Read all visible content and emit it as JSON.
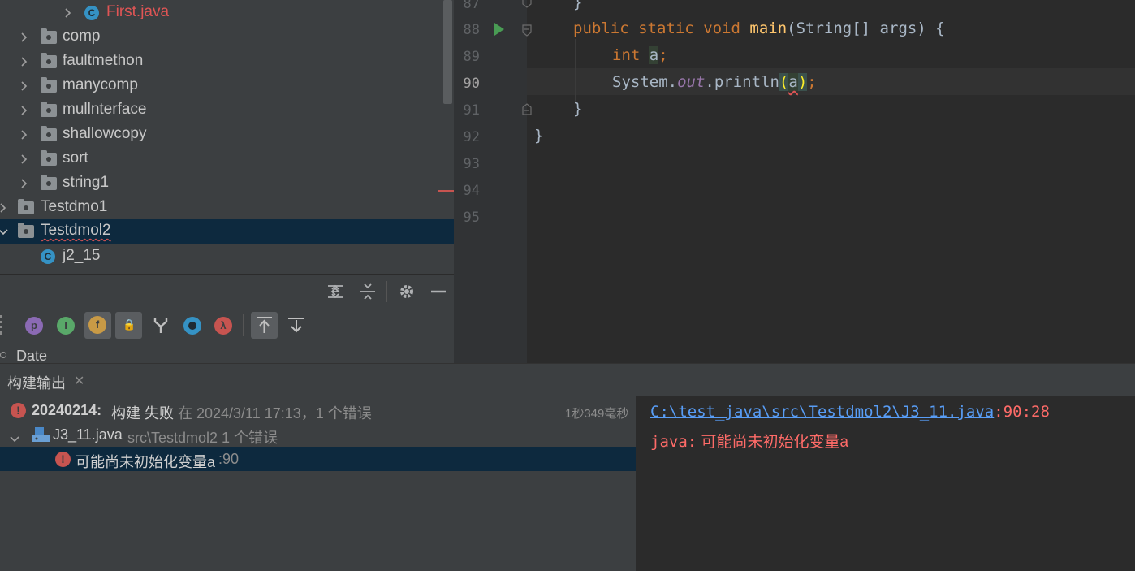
{
  "project_tree": {
    "items": [
      {
        "label": "First.java",
        "type": "class",
        "error": true
      },
      {
        "label": "comp",
        "type": "folder"
      },
      {
        "label": "faultmethon",
        "type": "folder"
      },
      {
        "label": "manycomp",
        "type": "folder"
      },
      {
        "label": "mullnterface",
        "type": "folder"
      },
      {
        "label": "shallowcopy",
        "type": "folder"
      },
      {
        "label": "sort",
        "type": "folder"
      },
      {
        "label": "string1",
        "type": "folder"
      },
      {
        "label": "Testdmo1",
        "type": "folder"
      },
      {
        "label": "Testdmol2",
        "type": "folder",
        "selected": true
      },
      {
        "label": "j2_15",
        "type": "class"
      }
    ],
    "class_icon_glyph": "C"
  },
  "structure": {
    "filter_icons": [
      "p",
      "I",
      "f",
      "🔒",
      "⑂",
      "●",
      "λ"
    ],
    "partial_label": "Date"
  },
  "editor": {
    "lines": [
      {
        "no": "87",
        "text": "}"
      },
      {
        "no": "88"
      },
      {
        "no": "89"
      },
      {
        "no": "90"
      },
      {
        "no": "91",
        "text": "}"
      },
      {
        "no": "92",
        "text": "}"
      },
      {
        "no": "93"
      },
      {
        "no": "94"
      },
      {
        "no": "95"
      }
    ],
    "tokens": {
      "public": "public",
      "static": "static",
      "void": "void",
      "main": "main",
      "sig": "(String[] args) {",
      "int": "int",
      "a": "a",
      "semi": ";",
      "system": "System.",
      "out": "out",
      "println": ".println",
      "lp": "(",
      "rp": ")"
    }
  },
  "build": {
    "tab_label": "构建输出",
    "summary": {
      "name": "20240214:",
      "status": "构建 失败",
      "detail": "在 2024/3/11 17:13，1 个错误",
      "duration": "1秒349毫秒"
    },
    "file": {
      "name": "J3_11.java",
      "path": "src\\Testdmol2 1 个错误"
    },
    "error": {
      "message": "可能尚未初始化变量a",
      "line": ":90"
    },
    "console": {
      "link": "C:\\test_java\\src\\Testdmol2\\J3_11.java",
      "pos": ":90:28",
      "prefix": "java:",
      "message": "可能尚未初始化变量a"
    }
  },
  "colors": {
    "selection": "#0d293e",
    "error": "#c75450",
    "keyword": "#cc7832",
    "function": "#ffc66d"
  }
}
